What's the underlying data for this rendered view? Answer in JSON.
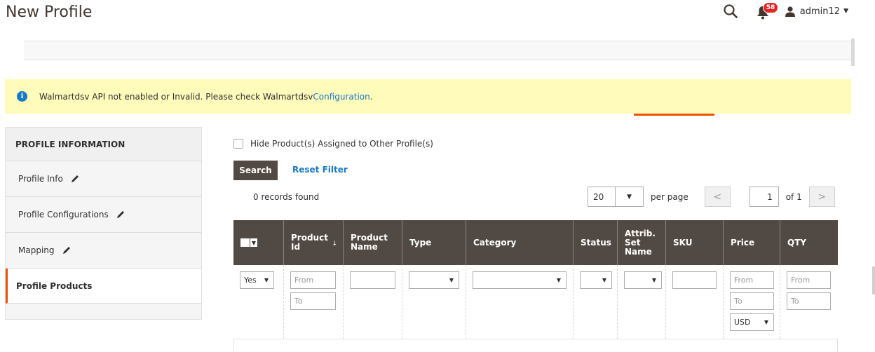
{
  "header": {
    "title": "New Profile",
    "notifications_count": "58",
    "user_name": "admin12"
  },
  "message": {
    "text": "Walmartdsv API not enabled or Invalid. Please check Walmartdsv ",
    "link_text": "Configuration",
    "suffix": "."
  },
  "sidebar": {
    "title": "PROFILE INFORMATION",
    "items": [
      {
        "label": "Profile Info"
      },
      {
        "label": "Profile Configurations"
      },
      {
        "label": "Mapping"
      },
      {
        "label": "Profile Products"
      }
    ]
  },
  "filters": {
    "hide_assigned_label": "Hide Product(s) Assigned to Other Profile(s)",
    "search_label": "Search",
    "reset_label": "Reset Filter",
    "records_found": "0 records found"
  },
  "pager": {
    "per_page_value": "20",
    "per_page_label": "per page",
    "prev": "<",
    "current_page": "1",
    "of_label": "of 1",
    "next": ">"
  },
  "grid": {
    "columns": [
      {
        "label": ""
      },
      {
        "label": "Product Id"
      },
      {
        "label": "Product Name"
      },
      {
        "label": "Type"
      },
      {
        "label": "Category"
      },
      {
        "label": "Status"
      },
      {
        "label": "Attrib. Set Name"
      },
      {
        "label": "SKU"
      },
      {
        "label": "Price"
      },
      {
        "label": "QTY"
      }
    ],
    "filter": {
      "massaction_value": "Yes",
      "from_placeholder": "From",
      "to_placeholder": "To",
      "currency_value": "USD"
    }
  },
  "colors": {
    "accent": "#eb5202",
    "header_bg": "#514943",
    "link": "#1979c3",
    "message_bg": "#fffbbb"
  }
}
